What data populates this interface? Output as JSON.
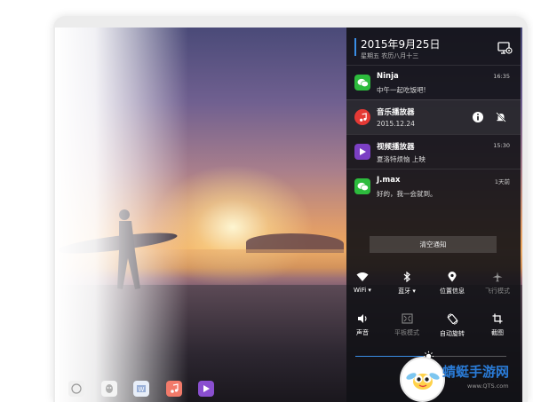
{
  "header": {
    "date": "2015年9月25日",
    "lunar": "星期五 农历八月十三",
    "settings_icon": "settings-monitor-icon"
  },
  "notifications": [
    {
      "app": "Ninja",
      "message": "中午一起吃饭吧!",
      "time": "16:35",
      "icon": "wechat-icon",
      "color": "#2dbb3d"
    },
    {
      "app": "音乐播放器",
      "message": "2015.12.24",
      "time": "",
      "icon": "music-icon",
      "color": "#e53935",
      "actions": [
        "info-icon",
        "mute-bell-icon"
      ]
    },
    {
      "app": "视频播放器",
      "message": "夏洛特烦恼 上映",
      "time": "15:30",
      "icon": "video-play-icon",
      "color": "#7b3fc4"
    },
    {
      "app": "J.max",
      "message": "好的，我一会就到。",
      "time": "1天前",
      "icon": "wechat-icon",
      "color": "#2dbb3d"
    }
  ],
  "clear_button": "清空通知",
  "quick_settings": {
    "row1": [
      {
        "label": "WiFi ▾",
        "icon": "wifi-icon",
        "active": true
      },
      {
        "label": "蓝牙 ▾",
        "icon": "bluetooth-icon",
        "active": true
      },
      {
        "label": "位置信息",
        "icon": "location-icon",
        "active": true
      },
      {
        "label": "飞行模式",
        "icon": "airplane-icon",
        "active": false
      }
    ],
    "row2": [
      {
        "label": "声音",
        "icon": "speaker-icon",
        "active": true
      },
      {
        "label": "平板模式",
        "icon": "tablet-mode-icon",
        "active": false
      },
      {
        "label": "自动旋转",
        "icon": "rotate-icon",
        "active": true
      },
      {
        "label": "截图",
        "icon": "crop-icon",
        "active": true
      }
    ]
  },
  "brightness": {
    "level": 0.48,
    "icon": "brightness-icon"
  },
  "dock": [
    "browser-icon",
    "qq-icon",
    "office-icon",
    "music-icon",
    "video-icon"
  ],
  "watermark": {
    "name": "蜻蜓手游网",
    "url": "www.QTS.com"
  },
  "colors": {
    "accent": "#3a8ee6",
    "panel": "#121216"
  }
}
